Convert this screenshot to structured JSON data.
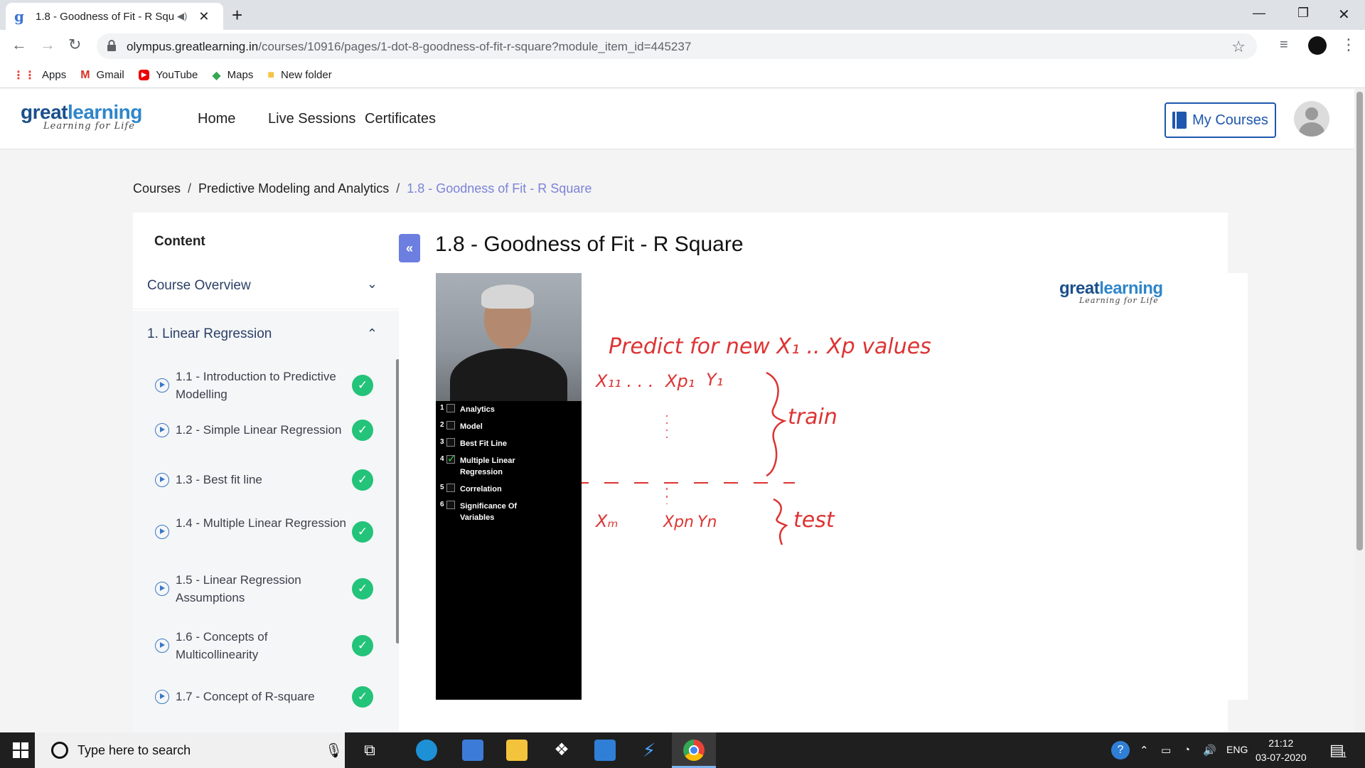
{
  "browser": {
    "tab_title": "1.8 - Goodness of Fit - R Squ",
    "tab_favicon": "gl",
    "url_domain": "olympus.greatlearning.in",
    "url_path": "/courses/10916/pages/1-dot-8-goodness-of-fit-r-square?module_item_id=445237",
    "bookmarks": [
      "Apps",
      "Gmail",
      "YouTube",
      "Maps",
      "New folder"
    ]
  },
  "site": {
    "logo_main_a": "great",
    "logo_main_b": "learning",
    "logo_sub": "Learning for Life",
    "nav": [
      "Home",
      "Live Sessions",
      "Certificates"
    ],
    "my_courses": "My Courses"
  },
  "breadcrumb": {
    "items": [
      "Courses",
      "Predictive Modeling and Analytics"
    ],
    "current": "1.8 - Goodness of Fit - R Square",
    "separator": "/"
  },
  "sidebar": {
    "heading": "Content",
    "sections": [
      "Course Overview",
      "1. Linear Regression"
    ],
    "lessons": [
      {
        "label": "1.1 - Introduction to Predictive Modelling",
        "done": true
      },
      {
        "label": "1.2 - Simple Linear Regression",
        "done": true
      },
      {
        "label": "1.3 - Best fit line",
        "done": true
      },
      {
        "label": "1.4 - Multiple Linear Regression",
        "done": true
      },
      {
        "label": "1.5 - Linear Regression Assumptions",
        "done": true
      },
      {
        "label": "1.6 - Concepts of Multicollinearity",
        "done": true
      },
      {
        "label": "1.7 - Concept of R-square",
        "done": true
      }
    ],
    "collapse_label": "«"
  },
  "main": {
    "title": "1.8 - Goodness of Fit - R Square"
  },
  "video": {
    "agenda": [
      {
        "num": "1",
        "label": "Analytics",
        "checked": false
      },
      {
        "num": "2",
        "label": "Model",
        "checked": false
      },
      {
        "num": "3",
        "label": "Best Fit Line",
        "checked": false
      },
      {
        "num": "4",
        "label": "Multiple Linear Regression",
        "checked": true
      },
      {
        "num": "5",
        "label": "Correlation",
        "checked": false
      },
      {
        "num": "6",
        "label": "Significance Of Variables",
        "checked": false
      }
    ],
    "whiteboard": {
      "line1": "Predict for new X₁ .. Xp values",
      "row1_a": "X₁₁ . . .",
      "row1_b": "Xp₁",
      "row1_c": "Y₁",
      "train": "train",
      "row2_a": "Xₘ",
      "row2_b": "Xpn",
      "row2_c": "Yn",
      "test": "test"
    }
  },
  "taskbar": {
    "search_placeholder": "Type here to search",
    "lang": "ENG",
    "time": "21:12",
    "date": "03-07-2020",
    "notification_count": "1"
  }
}
